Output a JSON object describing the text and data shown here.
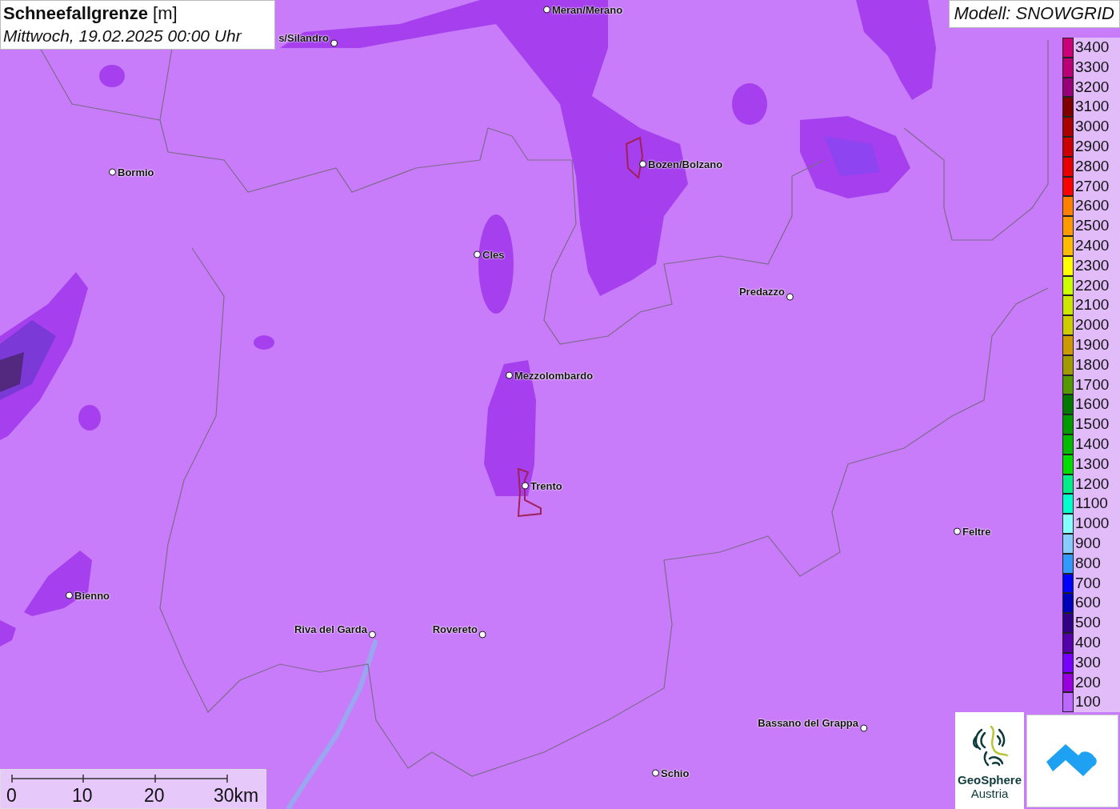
{
  "title": {
    "heading": "**Schneefallgrenze** [m]",
    "subtitle": "Mittwoch, 19.02.2025 00:00 Uhr"
  },
  "model_label": "Modell: SNOWGRID",
  "cities": [
    {
      "name": "Meran/Merano"
    },
    {
      "name": "s/Silandro"
    },
    {
      "name": "Bormio"
    },
    {
      "name": "Bozen/Bolzano"
    },
    {
      "name": "Cles"
    },
    {
      "name": "Predazzo"
    },
    {
      "name": "Mezzolombardo"
    },
    {
      "name": "Trento"
    },
    {
      "name": "Feltre"
    },
    {
      "name": "Bienno"
    },
    {
      "name": "Riva del Garda"
    },
    {
      "name": "Rovereto"
    },
    {
      "name": "Bassano del Grappa"
    },
    {
      "name": "Schio"
    }
  ],
  "legend": [
    {
      "label": "3400",
      "color": "#cc0077"
    },
    {
      "label": "3300",
      "color": "#bb0077"
    },
    {
      "label": "3200",
      "color": "#990077"
    },
    {
      "label": "3100",
      "color": "#800000"
    },
    {
      "label": "3000",
      "color": "#aa0000"
    },
    {
      "label": "2900",
      "color": "#cc0000"
    },
    {
      "label": "2800",
      "color": "#e60000"
    },
    {
      "label": "2700",
      "color": "#ff0000"
    },
    {
      "label": "2600",
      "color": "#ff8000"
    },
    {
      "label": "2500",
      "color": "#ff9900"
    },
    {
      "label": "2400",
      "color": "#ffbb00"
    },
    {
      "label": "2300",
      "color": "#ffff00"
    },
    {
      "label": "2200",
      "color": "#ccff00"
    },
    {
      "label": "2100",
      "color": "#cce600"
    },
    {
      "label": "2000",
      "color": "#cccc00"
    },
    {
      "label": "1900",
      "color": "#cc9900"
    },
    {
      "label": "1800",
      "color": "#a09900"
    },
    {
      "label": "1700",
      "color": "#559900"
    },
    {
      "label": "1600",
      "color": "#007700"
    },
    {
      "label": "1500",
      "color": "#009900"
    },
    {
      "label": "1400",
      "color": "#00bb00"
    },
    {
      "label": "1300",
      "color": "#00dd00"
    },
    {
      "label": "1200",
      "color": "#00ee88"
    },
    {
      "label": "1100",
      "color": "#00ffcc"
    },
    {
      "label": "1000",
      "color": "#88ffff"
    },
    {
      "label": "900",
      "color": "#88ccff"
    },
    {
      "label": "800",
      "color": "#3399ff"
    },
    {
      "label": "700",
      "color": "#0000ff"
    },
    {
      "label": "600",
      "color": "#0000bb"
    },
    {
      "label": "500",
      "color": "#330088"
    },
    {
      "label": "400",
      "color": "#5500aa"
    },
    {
      "label": "300",
      "color": "#7700ff"
    },
    {
      "label": "200",
      "color": "#9900dd"
    },
    {
      "label": "100",
      "color": "#bb66ff"
    }
  ],
  "scale_bar": [
    "0",
    "10",
    "20",
    "30km"
  ],
  "logo": {
    "name": "GeoSphere",
    "subtitle": "Austria"
  }
}
